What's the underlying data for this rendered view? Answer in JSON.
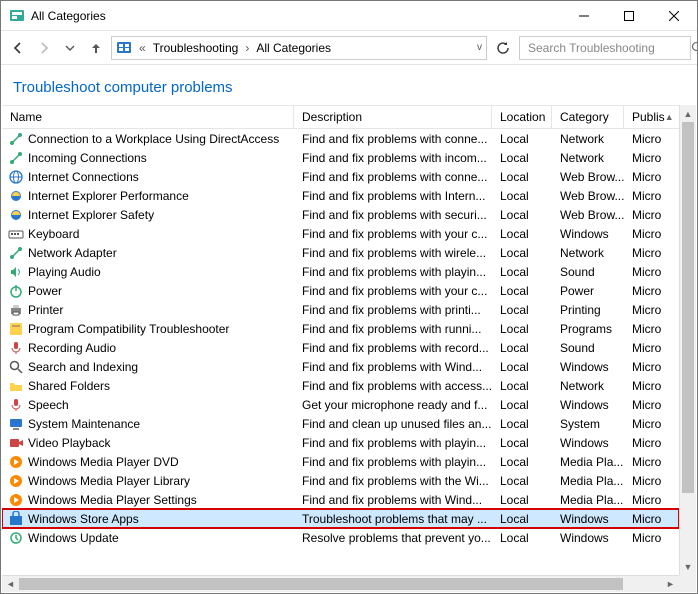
{
  "window": {
    "title": "All Categories"
  },
  "breadcrumb": {
    "root_icon": "control-panel-icon",
    "items": [
      "Troubleshooting",
      "All Categories"
    ]
  },
  "search": {
    "placeholder": "Search Troubleshooting"
  },
  "heading": "Troubleshoot computer problems",
  "columns": {
    "name": "Name",
    "description": "Description",
    "location": "Location",
    "category": "Category",
    "publisher": "Publis"
  },
  "rows": [
    {
      "name": "Connection to a Workplace Using DirectAccess",
      "desc": "Find and fix problems with conne...",
      "loc": "Local",
      "cat": "Network",
      "pub": "Micro",
      "icon": "network"
    },
    {
      "name": "Incoming Connections",
      "desc": "Find and fix problems with incom...",
      "loc": "Local",
      "cat": "Network",
      "pub": "Micro",
      "icon": "network"
    },
    {
      "name": "Internet Connections",
      "desc": "Find and fix problems with conne...",
      "loc": "Local",
      "cat": "Web Brow...",
      "pub": "Micro",
      "icon": "globe"
    },
    {
      "name": "Internet Explorer Performance",
      "desc": "Find and fix problems with Intern...",
      "loc": "Local",
      "cat": "Web Brow...",
      "pub": "Micro",
      "icon": "ie"
    },
    {
      "name": "Internet Explorer Safety",
      "desc": "Find and fix problems with securi...",
      "loc": "Local",
      "cat": "Web Brow...",
      "pub": "Micro",
      "icon": "ie"
    },
    {
      "name": "Keyboard",
      "desc": "Find and fix problems with your c...",
      "loc": "Local",
      "cat": "Windows",
      "pub": "Micro",
      "icon": "keyboard"
    },
    {
      "name": "Network Adapter",
      "desc": "Find and fix problems with wirele...",
      "loc": "Local",
      "cat": "Network",
      "pub": "Micro",
      "icon": "network"
    },
    {
      "name": "Playing Audio",
      "desc": "Find and fix problems with playin...",
      "loc": "Local",
      "cat": "Sound",
      "pub": "Micro",
      "icon": "audio"
    },
    {
      "name": "Power",
      "desc": "Find and fix problems with your c...",
      "loc": "Local",
      "cat": "Power",
      "pub": "Micro",
      "icon": "power"
    },
    {
      "name": "Printer",
      "desc": "Find and fix problems with printi...",
      "loc": "Local",
      "cat": "Printing",
      "pub": "Micro",
      "icon": "printer"
    },
    {
      "name": "Program Compatibility Troubleshooter",
      "desc": "Find and fix problems with runni...",
      "loc": "Local",
      "cat": "Programs",
      "pub": "Micro",
      "icon": "program"
    },
    {
      "name": "Recording Audio",
      "desc": "Find and fix problems with record...",
      "loc": "Local",
      "cat": "Sound",
      "pub": "Micro",
      "icon": "mic"
    },
    {
      "name": "Search and Indexing",
      "desc": "Find and fix problems with Wind...",
      "loc": "Local",
      "cat": "Windows",
      "pub": "Micro",
      "icon": "search"
    },
    {
      "name": "Shared Folders",
      "desc": "Find and fix problems with access...",
      "loc": "Local",
      "cat": "Network",
      "pub": "Micro",
      "icon": "folder"
    },
    {
      "name": "Speech",
      "desc": "Get your microphone ready and f...",
      "loc": "Local",
      "cat": "Windows",
      "pub": "Micro",
      "icon": "mic"
    },
    {
      "name": "System Maintenance",
      "desc": "Find and clean up unused files an...",
      "loc": "Local",
      "cat": "System",
      "pub": "Micro",
      "icon": "system"
    },
    {
      "name": "Video Playback",
      "desc": "Find and fix problems with playin...",
      "loc": "Local",
      "cat": "Windows",
      "pub": "Micro",
      "icon": "video"
    },
    {
      "name": "Windows Media Player DVD",
      "desc": "Find and fix problems with playin...",
      "loc": "Local",
      "cat": "Media Pla...",
      "pub": "Micro",
      "icon": "wmp"
    },
    {
      "name": "Windows Media Player Library",
      "desc": "Find and fix problems with the Wi...",
      "loc": "Local",
      "cat": "Media Pla...",
      "pub": "Micro",
      "icon": "wmp"
    },
    {
      "name": "Windows Media Player Settings",
      "desc": "Find and fix problems with Wind...",
      "loc": "Local",
      "cat": "Media Pla...",
      "pub": "Micro",
      "icon": "wmp"
    },
    {
      "name": "Windows Store Apps",
      "desc": "Troubleshoot problems that may ...",
      "loc": "Local",
      "cat": "Windows",
      "pub": "Micro",
      "icon": "store",
      "selected": true,
      "highlight": true
    },
    {
      "name": "Windows Update",
      "desc": "Resolve problems that prevent yo...",
      "loc": "Local",
      "cat": "Windows",
      "pub": "Micro",
      "icon": "update"
    }
  ]
}
